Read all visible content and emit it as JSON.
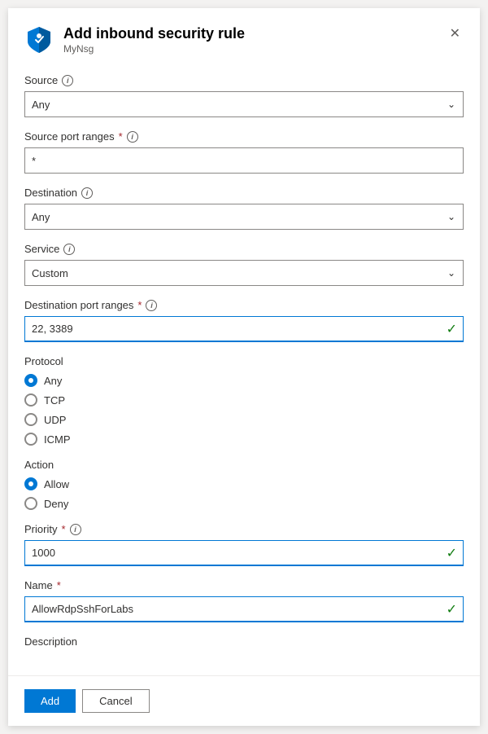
{
  "panel": {
    "title": "Add inbound security rule",
    "subtitle": "MyNsg"
  },
  "fields": {
    "source": {
      "label": "Source",
      "value": "Any"
    },
    "source_port_ranges": {
      "label": "Source port ranges",
      "required": true,
      "value": "*"
    },
    "destination": {
      "label": "Destination",
      "value": "Any"
    },
    "service": {
      "label": "Service",
      "value": "Custom"
    },
    "destination_port_ranges": {
      "label": "Destination port ranges",
      "required": true,
      "value": "22, 3389"
    },
    "protocol": {
      "label": "Protocol",
      "options": [
        "Any",
        "TCP",
        "UDP",
        "ICMP"
      ],
      "selected": "Any"
    },
    "action": {
      "label": "Action",
      "options": [
        "Allow",
        "Deny"
      ],
      "selected": "Allow"
    },
    "priority": {
      "label": "Priority",
      "required": true,
      "value": "1000"
    },
    "name": {
      "label": "Name",
      "required": true,
      "value": "AllowRdpSshForLabs"
    },
    "description": {
      "label": "Description"
    }
  },
  "buttons": {
    "add": "Add",
    "cancel": "Cancel"
  },
  "icons": {
    "close": "✕",
    "chevron_down": "⌄",
    "check": "✓",
    "info": "i"
  },
  "colors": {
    "accent_blue": "#0078d4",
    "valid_green": "#107c10",
    "required_red": "#a4262c"
  }
}
